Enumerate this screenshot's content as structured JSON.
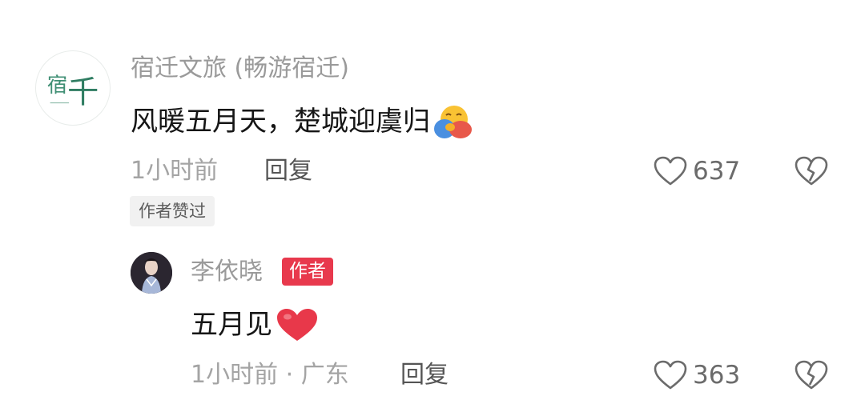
{
  "comment": {
    "username": "宿迁文旅 (畅游宿迁)",
    "avatar_text": "宿千",
    "text": "风暖五月天，楚城迎虞归",
    "emoji": "hugging-face-emoji",
    "time": "1小时前",
    "reply_label": "回复",
    "like_count": "637",
    "author_liked_label": "作者赞过"
  },
  "reply": {
    "username": "李依晓",
    "author_badge": "作者",
    "text": "五月见",
    "emoji": "red-heart-emoji",
    "time_location": "1小时前 · 广东",
    "reply_label": "回复",
    "like_count": "363"
  },
  "colors": {
    "author_badge": "#e8394d",
    "heart_emoji": "#e8384a",
    "avatar_ink": "#3f8f74"
  }
}
